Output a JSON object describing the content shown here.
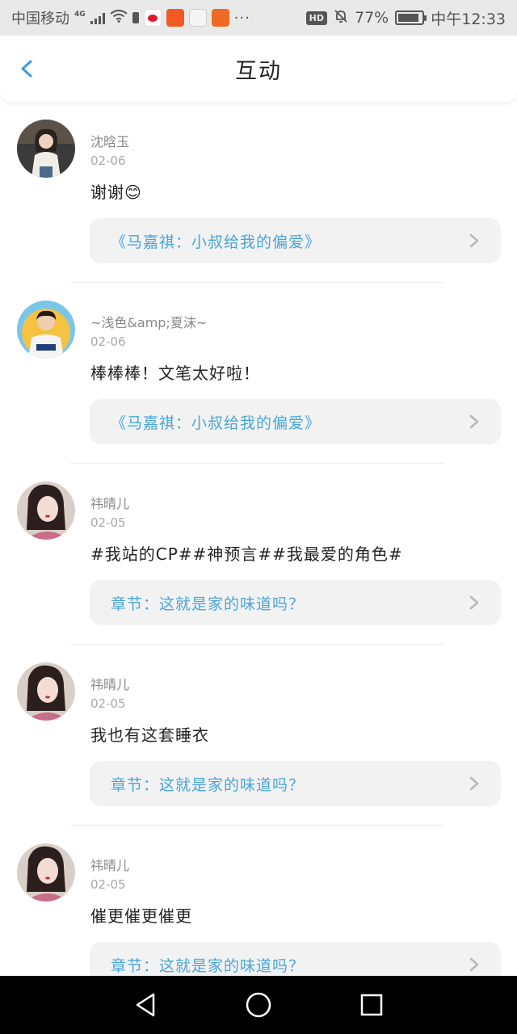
{
  "status_bar": {
    "carrier": "中国移动",
    "network": "4G",
    "dots": "···",
    "hd": "HD",
    "battery_percent": "77%",
    "battery_level": 0.77,
    "time": "中午12:33"
  },
  "header": {
    "title": "互动"
  },
  "colors": {
    "accent": "#4aa5d8",
    "back_arrow": "#3a9fe0"
  },
  "items": [
    {
      "name": "沈晗玉",
      "date": "02-06",
      "comment": "谢谢😊",
      "card": "《马嘉祺：小叔给我的偏爱》"
    },
    {
      "name": "~浅色&amp;夏沫~",
      "date": "02-06",
      "comment": "棒棒棒！文笔太好啦！",
      "card": "《马嘉祺：小叔给我的偏爱》"
    },
    {
      "name": "祎晴儿",
      "date": "02-05",
      "comment": "#我站的CP##神预言##我最爱的角色#",
      "card": "章节：这就是家的味道吗？"
    },
    {
      "name": "祎晴儿",
      "date": "02-05",
      "comment": "我也有这套睡衣",
      "card": "章节：这就是家的味道吗？"
    },
    {
      "name": "祎晴儿",
      "date": "02-05",
      "comment": "催更催更催更",
      "card": "章节：这就是家的味道吗？"
    }
  ],
  "icons": {
    "back": "back-arrow-icon",
    "chevron": "chevron-right-icon",
    "nav_back": "nav-back-icon",
    "nav_home": "nav-home-icon",
    "nav_recents": "nav-recents-icon"
  }
}
